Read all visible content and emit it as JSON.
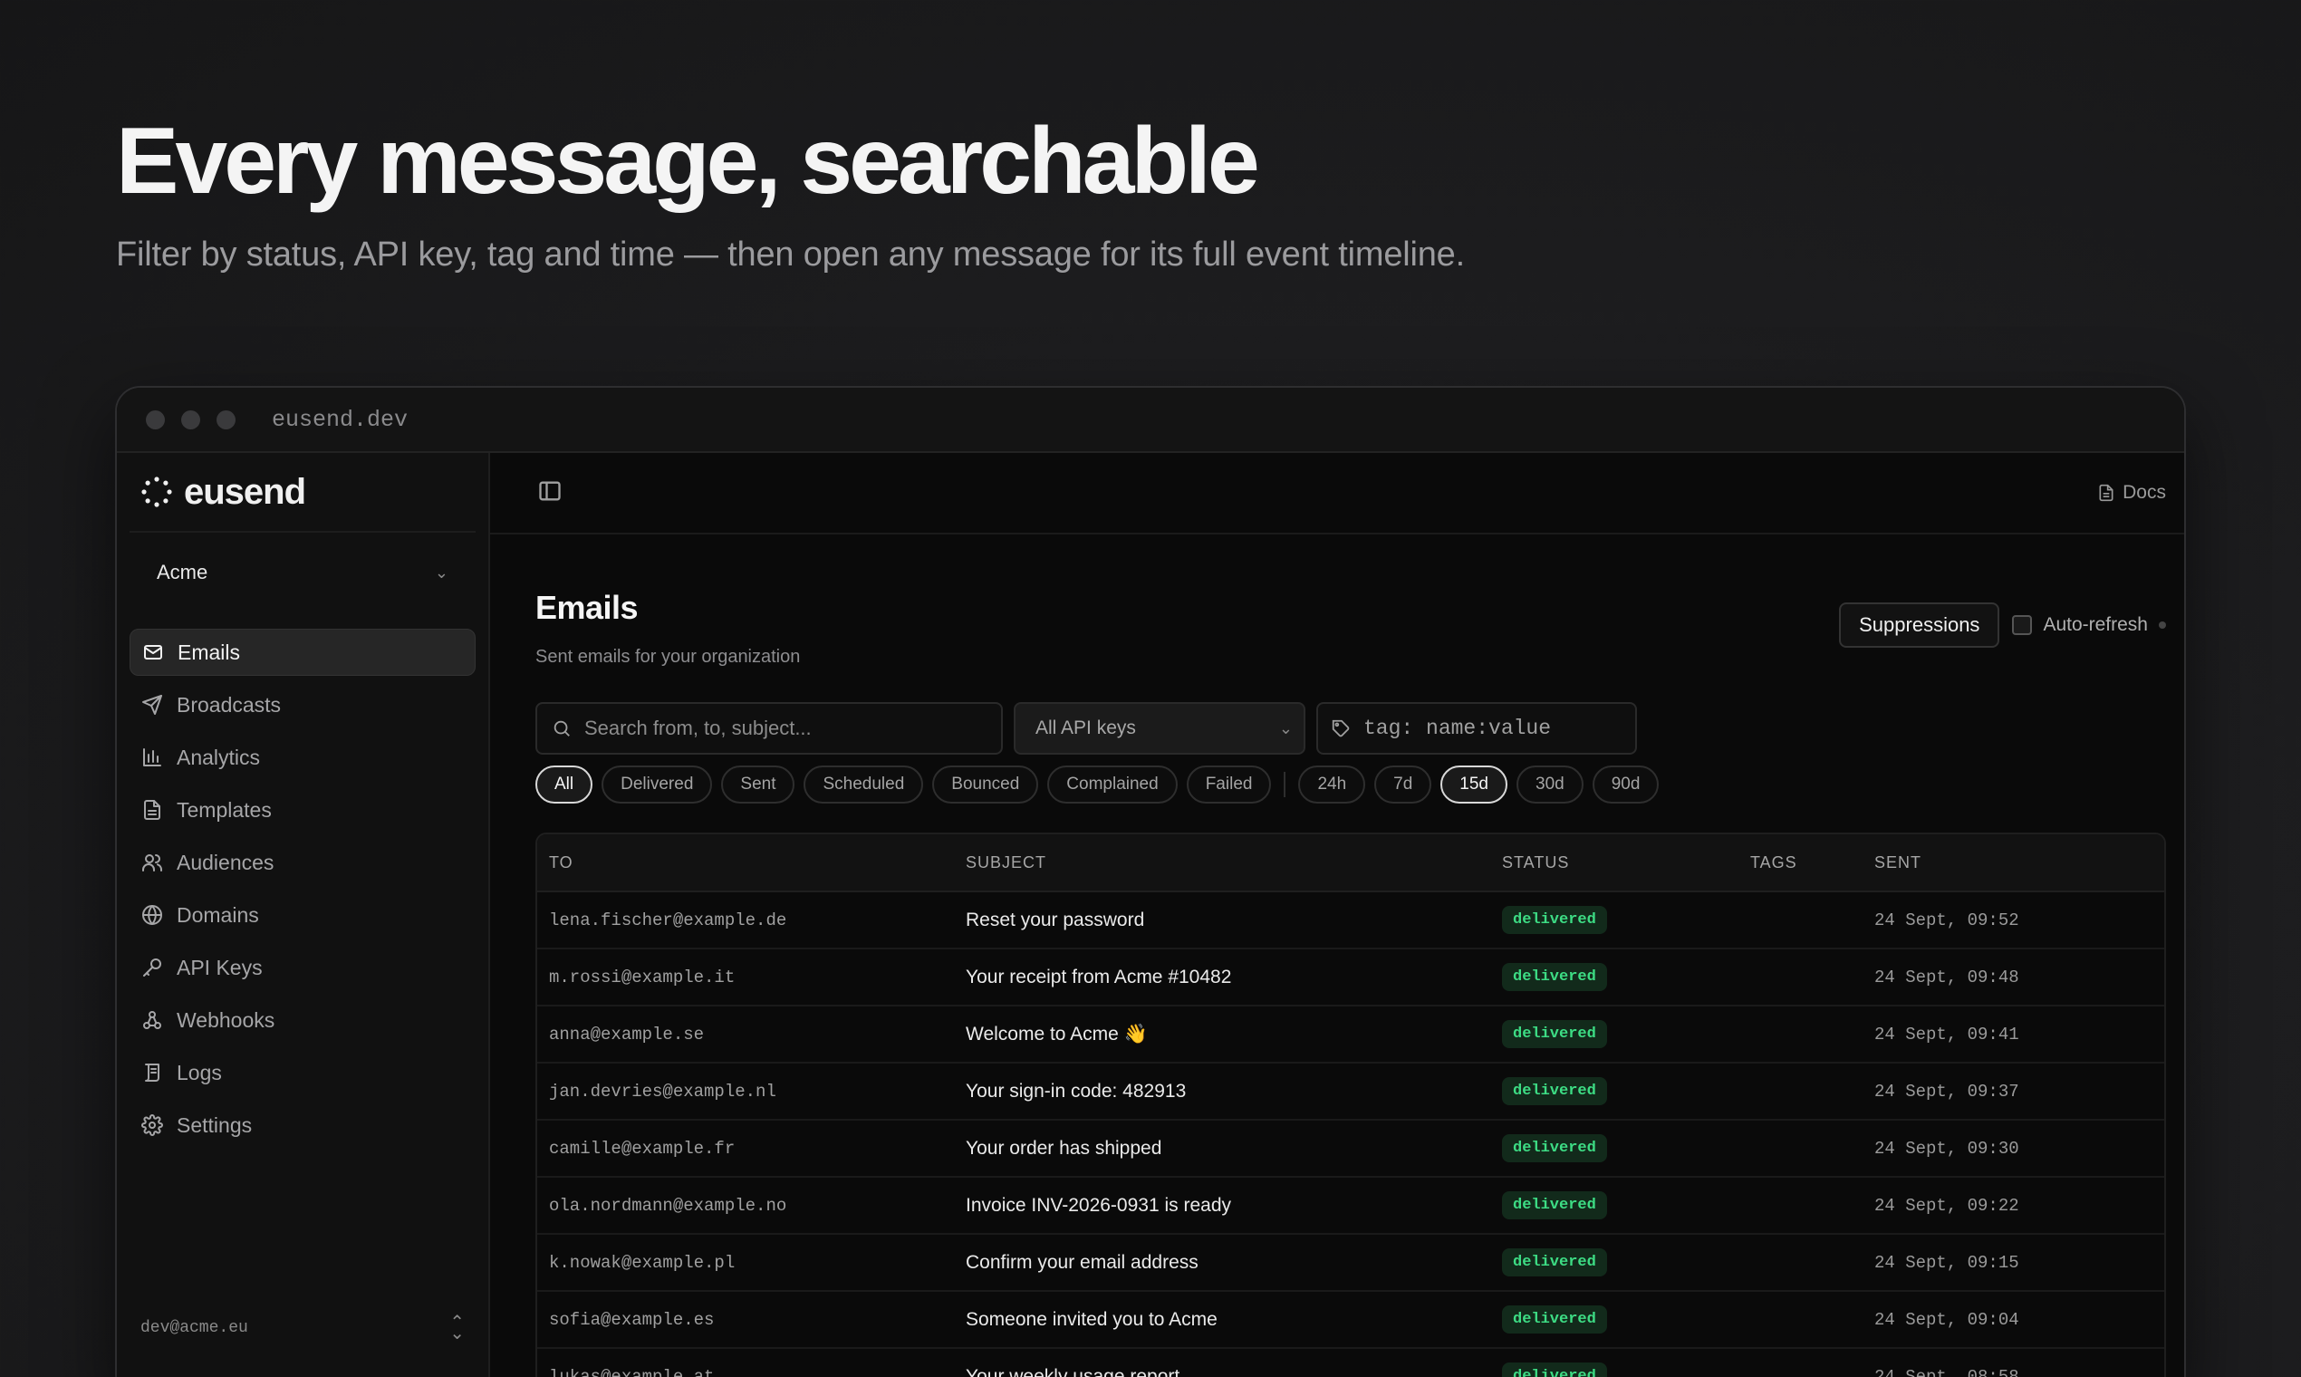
{
  "hero": {
    "title": "Every message, searchable",
    "subtitle": "Filter by status, API key, tag and time — then open any message for its full event timeline."
  },
  "window": {
    "url": "eusend.dev"
  },
  "sidebar": {
    "brand": "eusend",
    "org": "Acme",
    "items": [
      {
        "label": "Emails",
        "icon": "mail-icon",
        "active": true
      },
      {
        "label": "Broadcasts",
        "icon": "send-icon"
      },
      {
        "label": "Analytics",
        "icon": "bar-chart-icon"
      },
      {
        "label": "Templates",
        "icon": "document-icon"
      },
      {
        "label": "Audiences",
        "icon": "users-icon"
      },
      {
        "label": "Domains",
        "icon": "globe-icon"
      },
      {
        "label": "API Keys",
        "icon": "key-icon"
      },
      {
        "label": "Webhooks",
        "icon": "webhook-icon"
      },
      {
        "label": "Logs",
        "icon": "logs-icon"
      },
      {
        "label": "Settings",
        "icon": "gear-icon"
      }
    ],
    "user_email": "dev@acme.eu"
  },
  "topbar": {
    "docs_label": "Docs"
  },
  "page": {
    "title": "Emails",
    "subtitle": "Sent emails for your organization",
    "suppressions_label": "Suppressions",
    "auto_refresh_label": "Auto-refresh"
  },
  "filters": {
    "search_placeholder": "Search from, to, subject...",
    "api_key_value": "All API keys",
    "tag_placeholder": "tag: name:value",
    "status_chips": [
      "All",
      "Delivered",
      "Sent",
      "Scheduled",
      "Bounced",
      "Complained",
      "Failed"
    ],
    "active_status": "All",
    "time_chips": [
      "24h",
      "7d",
      "15d",
      "30d",
      "90d"
    ],
    "active_time": "15d"
  },
  "table": {
    "headers": {
      "to": "TO",
      "subject": "SUBJECT",
      "status": "STATUS",
      "tags": "TAGS",
      "sent": "SENT"
    },
    "rows": [
      {
        "to": "lena.fischer@example.de",
        "subject": "Reset your password",
        "status": "delivered",
        "sent": "24 Sept, 09:52"
      },
      {
        "to": "m.rossi@example.it",
        "subject": "Your receipt from Acme #10482",
        "status": "delivered",
        "sent": "24 Sept, 09:48"
      },
      {
        "to": "anna@example.se",
        "subject": "Welcome to Acme 👋",
        "status": "delivered",
        "sent": "24 Sept, 09:41"
      },
      {
        "to": "jan.devries@example.nl",
        "subject": "Your sign-in code: 482913",
        "status": "delivered",
        "sent": "24 Sept, 09:37"
      },
      {
        "to": "camille@example.fr",
        "subject": "Your order has shipped",
        "status": "delivered",
        "sent": "24 Sept, 09:30"
      },
      {
        "to": "ola.nordmann@example.no",
        "subject": "Invoice INV-2026-0931 is ready",
        "status": "delivered",
        "sent": "24 Sept, 09:22"
      },
      {
        "to": "k.nowak@example.pl",
        "subject": "Confirm your email address",
        "status": "delivered",
        "sent": "24 Sept, 09:15"
      },
      {
        "to": "sofia@example.es",
        "subject": "Someone invited you to Acme",
        "status": "delivered",
        "sent": "24 Sept, 09:04"
      },
      {
        "to": "lukas@example.at",
        "subject": "Your weekly usage report",
        "status": "delivered",
        "sent": "24 Sept, 08:58"
      }
    ]
  },
  "colors": {
    "delivered": "#3ddc84",
    "background": "#0a0a0a"
  }
}
